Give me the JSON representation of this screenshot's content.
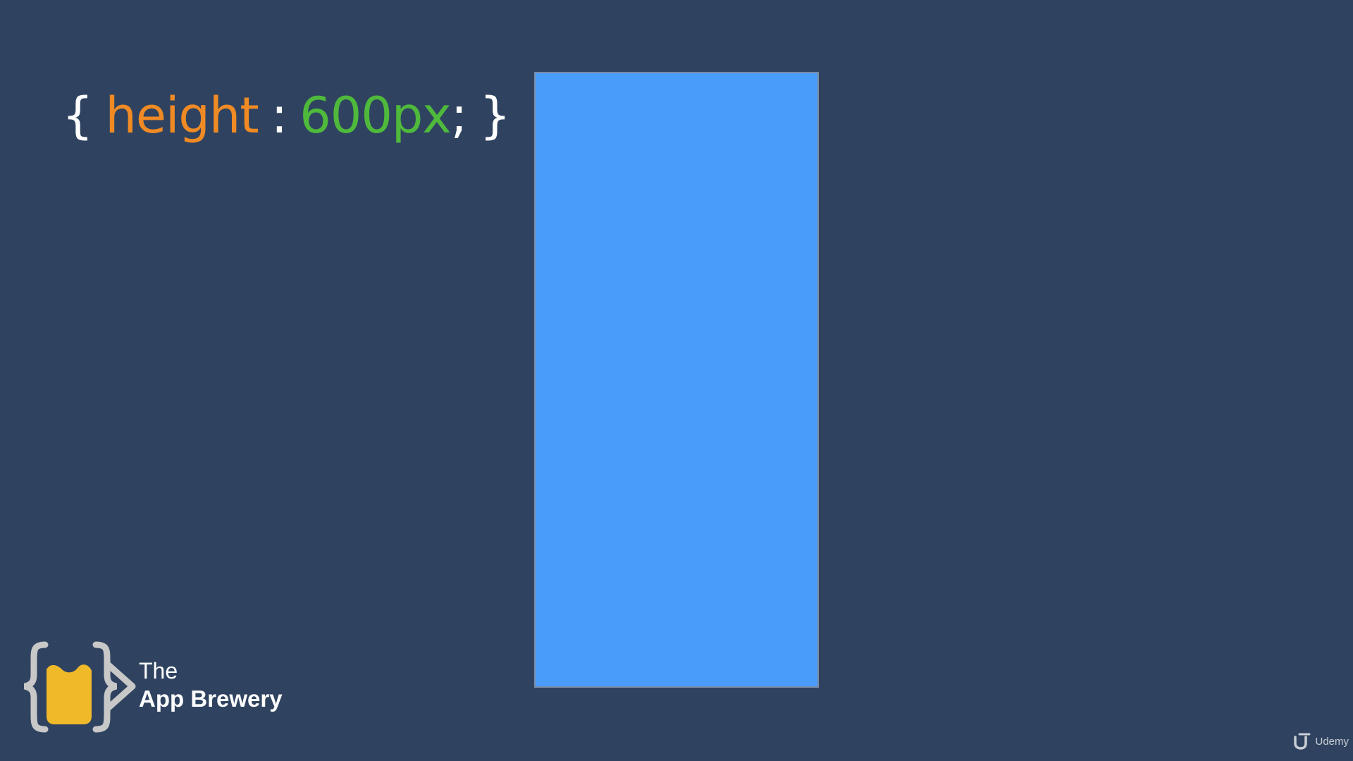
{
  "code": {
    "open_brace": "{",
    "property": "height",
    "colon": ":",
    "value": "600px",
    "semicolon": ";",
    "close_brace": "}"
  },
  "logo": {
    "line1": "The",
    "line2": "App Brewery"
  },
  "watermark": {
    "text": "Udemy",
    "icon": "udemy-u-icon"
  },
  "colors": {
    "background": "#2f4360",
    "property": "#f08a24",
    "value": "#4fb93c",
    "punctuation": "#ffffff",
    "box": "#4a9cfb",
    "logo_mug": "#f0b92a",
    "logo_braces": "#c8c8c8",
    "watermark": "#c9ced6"
  },
  "icons": {
    "logo": "app-brewery-logo-icon"
  }
}
